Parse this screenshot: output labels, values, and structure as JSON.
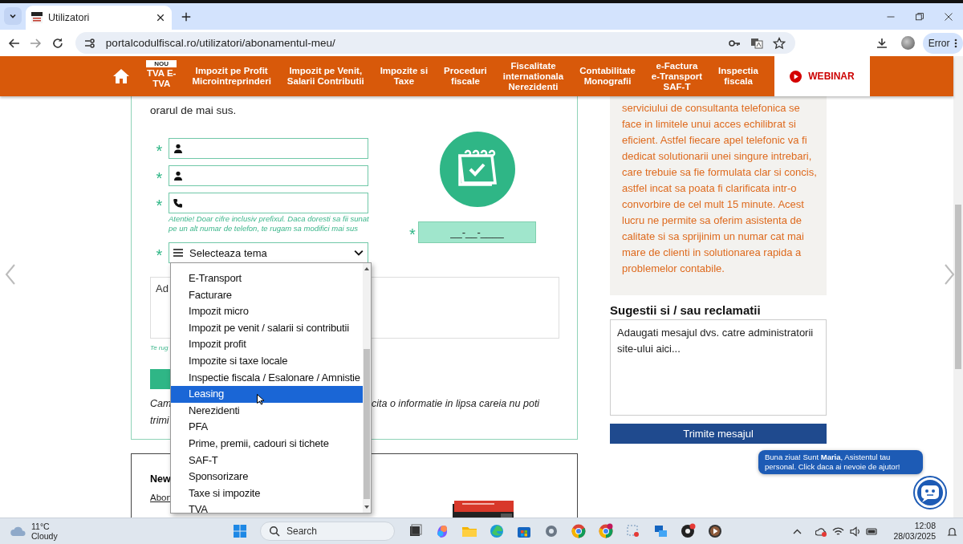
{
  "browser": {
    "tab_title": "Utilizatori",
    "url": "portalcodulfiscal.ro/utilizatori/abonamentul-meu/",
    "profile_button": "Error"
  },
  "nav": {
    "items": [
      {
        "label": "TVA E-\nTVA",
        "badge": "NOU"
      },
      {
        "label": "Impozit pe Profit\nMicrointreprinderi"
      },
      {
        "label": "Impozit pe Venit,\nSalarii Contributii"
      },
      {
        "label": "Impozite si\nTaxe"
      },
      {
        "label": "Proceduri\nfiscale"
      },
      {
        "label": "Fiscalitate\ninternationala\nNerezidenti"
      },
      {
        "label": "Contabilitate\nMonografii"
      },
      {
        "label": "e-Factura\ne-Transport\nSAF-T"
      },
      {
        "label": "Inspectia\nfiscala"
      }
    ],
    "webinar": "WEBINAR"
  },
  "form": {
    "intro": "orarul de mai sus.",
    "fields": [
      {
        "kind": "person",
        "mark": "*"
      },
      {
        "kind": "person",
        "mark": "*"
      },
      {
        "kind": "phone",
        "mark": "*"
      }
    ],
    "phone_hint": "Atentie! Doar cifre inclusiv prefixul. Daca doresti sa fii sunat pe un alt numar de telefon, te rugam sa modifici mai sus",
    "topic_select": {
      "mark": "*",
      "value": "Selecteaza tema"
    },
    "date_field": {
      "mark": "*",
      "value": "__-__-____"
    },
    "message_box": {
      "placeholder": "Ad"
    },
    "message_hint": "Te rug",
    "note": {
      "line_1_start": "Cam",
      "line_1_end": "cita o informatie in lipsa careia nu poti",
      "line_2_start": "trimi"
    }
  },
  "dropdown": {
    "options": [
      {
        "label": "E-Transport",
        "selected": false
      },
      {
        "label": "Facturare",
        "selected": false
      },
      {
        "label": "Impozit micro",
        "selected": false
      },
      {
        "label": "Impozit pe venit / salarii si contributii",
        "selected": false
      },
      {
        "label": "Impozit profit",
        "selected": false
      },
      {
        "label": "Impozite si taxe locale",
        "selected": false
      },
      {
        "label": "Inspectie fiscala / Esalonare / Amnistie",
        "selected": false
      },
      {
        "label": "Leasing",
        "selected": true
      },
      {
        "label": "Nerezidenti",
        "selected": false
      },
      {
        "label": "PFA",
        "selected": false
      },
      {
        "label": "Prime, premii, cadouri si tichete",
        "selected": false
      },
      {
        "label": "SAF-T",
        "selected": false
      },
      {
        "label": "Sponsorizare",
        "selected": false
      },
      {
        "label": "Taxe si impozite",
        "selected": false
      },
      {
        "label": "TVA",
        "selected": false
      }
    ]
  },
  "newsletter": {
    "title": "New",
    "link": "Abon"
  },
  "sidebar": {
    "info_text": "serviciului de consultanta telefonica se face in limitele unui acces echilibrat si eficient. Astfel fiecare apel telefonic va fi dedicat solutionarii unei singure intrebari, care trebuie sa fie formulata clar si concis, astfel incat sa poata fi clarificata intr-o convorbire de cel mult 15 minute. Acest lucru ne permite sa oferim asistenta de calitate si sa sprijinim un numar cat mai mare de clienti in solutionarea rapida a problemelor contabile.",
    "suggestions_title": "Sugestii si / sau reclamatii",
    "suggestions_placeholder": "Adaugati mesajul dvs. catre administratorii site-ului aici...",
    "send_button": "Trimite mesajul"
  },
  "chat": {
    "message": "Buna ziua! Sunt **Maria**, Asistentul tau personal. Click daca ai nevoie de ajutor!"
  },
  "taskbar": {
    "temperature": "11°C",
    "weather": "Cloudy",
    "search": "Search",
    "time": "12:08",
    "date": "28/03/2025"
  }
}
